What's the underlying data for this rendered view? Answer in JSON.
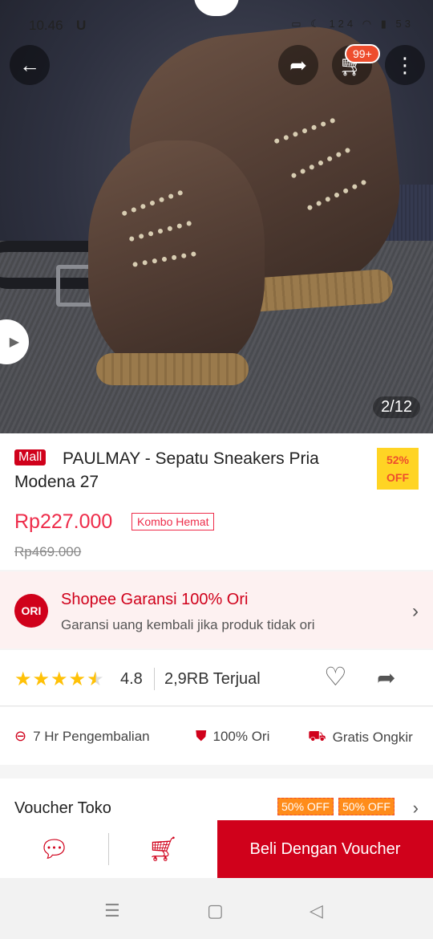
{
  "status_bar": {
    "time": "10.46",
    "carrier_icon": "U",
    "network_speed": "124",
    "battery": "53"
  },
  "image": {
    "counter": "2/12"
  },
  "header": {
    "cart_badge": "99+"
  },
  "product": {
    "mall_badge": "Mall",
    "title": "PAULMAY - Sepatu Sneakers Pria Modena 27",
    "discount_percent": "52%",
    "discount_label": "OFF",
    "price": "Rp227.000",
    "promo_tag": "Kombo Hemat",
    "original_price": "Rp469.000"
  },
  "guarantee": {
    "icon_text": "ORI",
    "title": "Shopee Garansi 100% Ori",
    "subtitle": "Garansi uang kembali jika produk tidak ori"
  },
  "rating": {
    "value": "4.8",
    "sold": "2,9RB Terjual",
    "stars": 4.5
  },
  "features": [
    {
      "label": "7 Hr Pengembalian"
    },
    {
      "label": "100% Ori"
    },
    {
      "label": "Gratis Ongkir"
    }
  ],
  "voucher": {
    "label": "Voucher Toko",
    "tags": [
      "50% OFF",
      "50% OFF"
    ]
  },
  "bottom_bar": {
    "buy_label": "Beli Dengan Voucher"
  },
  "colors": {
    "brand_red": "#d0011b",
    "price_red": "#ee2c4a",
    "discount_yellow": "#ffd424"
  }
}
